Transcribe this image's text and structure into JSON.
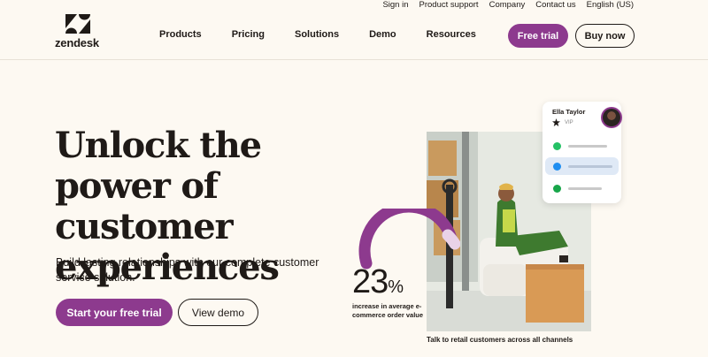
{
  "utility_nav": [
    "Sign in",
    "Product support",
    "Company",
    "Contact us",
    "English (US)"
  ],
  "brand": {
    "wordmark": "zendesk",
    "accent": "#8d3a8e"
  },
  "nav": [
    "Products",
    "Pricing",
    "Solutions",
    "Demo",
    "Resources"
  ],
  "header_buttons": {
    "trial": "Free trial",
    "buy": "Buy now"
  },
  "hero": {
    "headline": "Unlock the power of customer experiences",
    "subtext": "Build lasting relationships with our complete customer service solution.",
    "cta_primary": "Start your free trial",
    "cta_secondary": "View demo"
  },
  "stat": {
    "value": "23",
    "unit": "%",
    "label": "increase in average e-commerce order value"
  },
  "contact_card": {
    "name": "Ella Taylor",
    "tag": "VIP",
    "channels": [
      {
        "icon": "whatsapp-icon",
        "color": "#25c165"
      },
      {
        "icon": "messenger-icon",
        "color": "#1f8ef1",
        "selected": true
      },
      {
        "icon": "sms-icon",
        "color": "#18a64a"
      }
    ]
  },
  "image_caption": "Talk to retail customers across all channels"
}
